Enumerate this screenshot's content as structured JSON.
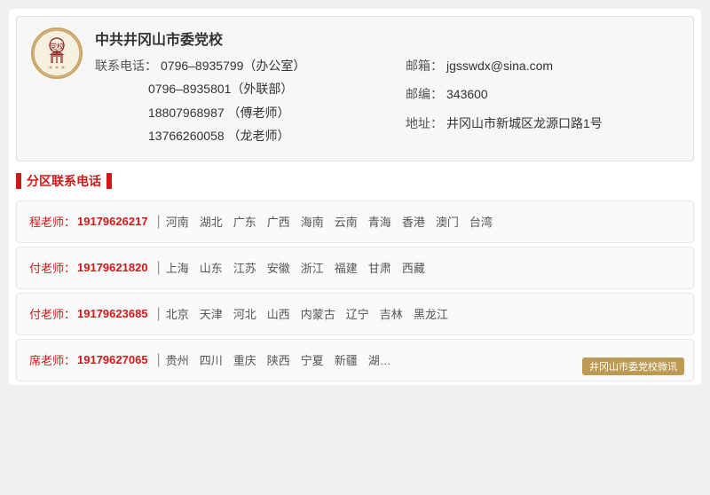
{
  "header": {
    "org_name": "中共井冈山市委党校",
    "logo_text": "党校",
    "phones": [
      {
        "label": "联系电话：",
        "value": "0796–8935799（办公室）"
      },
      {
        "label": "",
        "value": "0796–8935801（外联部）"
      },
      {
        "label": "",
        "value": "18807968987  （傅老师）"
      },
      {
        "label": "",
        "value": "13766260058  （龙老师）"
      }
    ],
    "email_label": "邮箱：",
    "email_value": "jgsswdx@sina.com",
    "postcode_label": "邮编：",
    "postcode_value": "343600",
    "address_label": "地址：",
    "address_value": "井冈山市新城区龙源口路1号"
  },
  "section_title": "分区联系电话",
  "teachers": [
    {
      "name": "程老师：",
      "phone": "19179626217",
      "regions": [
        "河南",
        "湖北",
        "广东",
        "广西",
        "海南",
        "云南",
        "青海",
        "香港",
        "澳门",
        "台湾"
      ]
    },
    {
      "name": "付老师：",
      "phone": "19179621820",
      "regions": [
        "上海",
        "山东",
        "江苏",
        "安徽",
        "浙江",
        "福建",
        "甘肃",
        "西藏"
      ]
    },
    {
      "name": "付老师：",
      "phone": "19179623685",
      "regions": [
        "北京",
        "天津",
        "河北",
        "山西",
        "内蒙古",
        "辽宁",
        "吉林",
        "黑龙江"
      ]
    },
    {
      "name": "席老师：",
      "phone": "19179627065",
      "regions": [
        "贵州",
        "四川",
        "重庆",
        "陕西",
        "宁夏",
        "新疆",
        "湖…"
      ],
      "has_watermark": true,
      "watermark_text": "井冈山市委党校微讯"
    }
  ],
  "colors": {
    "accent": "#cc1a1a",
    "card_bg": "#fafafa",
    "border": "#e8e8e8"
  }
}
